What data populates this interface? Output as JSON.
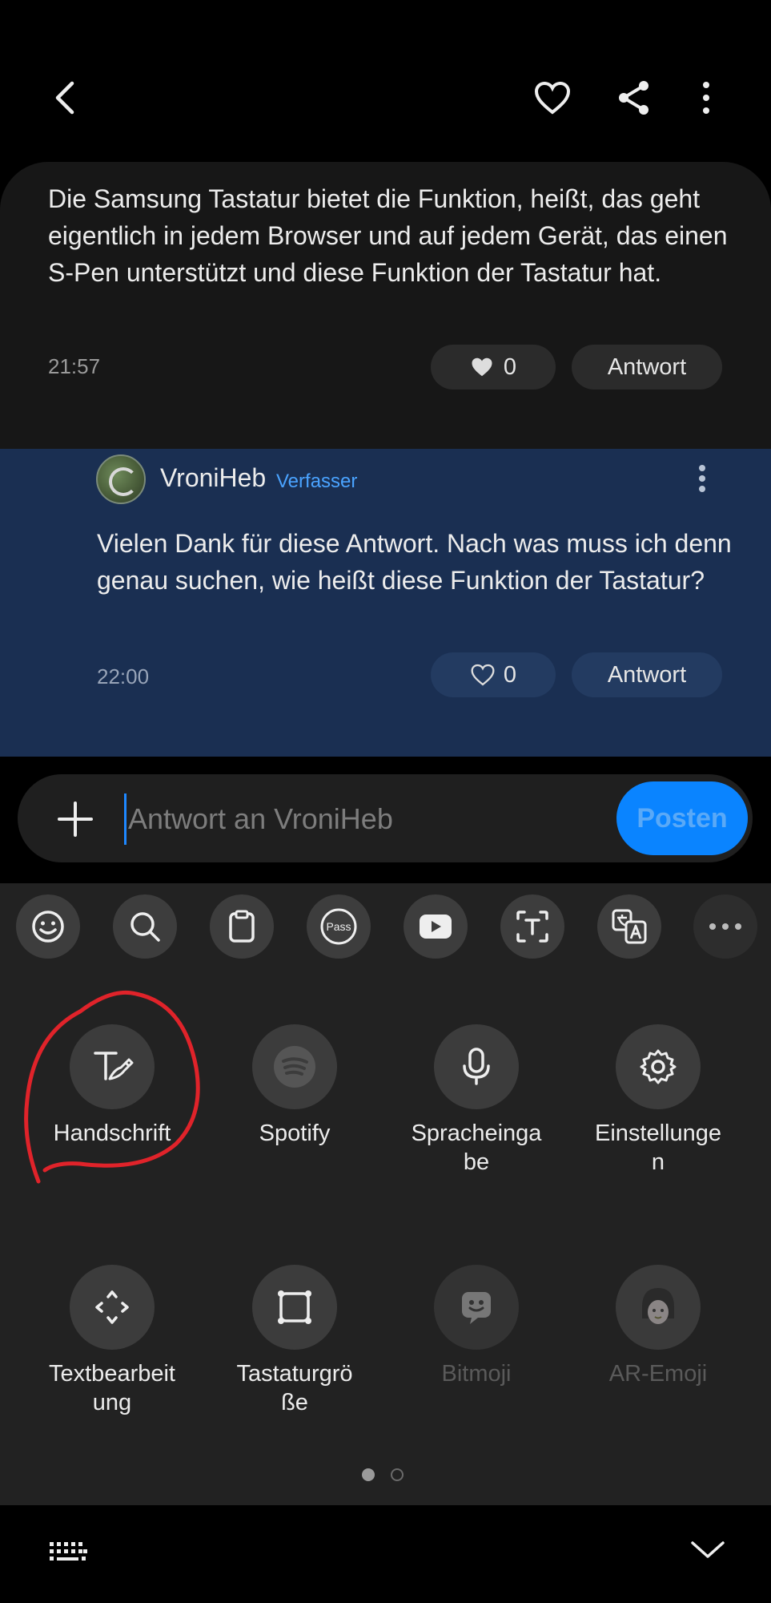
{
  "topbar": {
    "back_icon": "back-arrow-icon",
    "favorite_icon": "heart-outline-icon",
    "share_icon": "share-icon",
    "more_icon": "more-vertical-icon"
  },
  "comment": {
    "text": "Die Samsung Tastatur bietet die Funktion, heißt, das geht eigentlich in jedem Browser und auf jedem Gerät, das einen S-Pen unterstützt und diese Funktion der Tastatur hat.",
    "time": "21:57",
    "likes": "0",
    "reply_label": "Antwort"
  },
  "reply": {
    "author": "VroniHeb",
    "badge": "Verfasser",
    "text": "Vielen Dank für diese Antwort. Nach was muss ich denn genau suchen, wie heißt diese Funktion der Tastatur?",
    "time": "22:00",
    "likes": "0",
    "reply_label": "Antwort"
  },
  "input": {
    "placeholder": "Antwort an VroniHeb",
    "value": "",
    "post_label": "Posten"
  },
  "keyboard": {
    "toolbar": [
      {
        "icon": "emoji-icon"
      },
      {
        "icon": "search-icon"
      },
      {
        "icon": "clipboard-icon"
      },
      {
        "icon": "samsung-pass-icon",
        "text": "Pass"
      },
      {
        "icon": "youtube-icon"
      },
      {
        "icon": "text-extract-icon"
      },
      {
        "icon": "translate-icon"
      },
      {
        "icon": "more-horizontal-icon"
      }
    ],
    "tiles": [
      {
        "label": "Handschrift",
        "icon": "handwriting-icon",
        "enabled": true
      },
      {
        "label": "Spotify",
        "icon": "spotify-icon",
        "enabled": true
      },
      {
        "label": "Spracheinga\nbe",
        "icon": "microphone-icon",
        "enabled": true
      },
      {
        "label": "Einstellunge\nn",
        "icon": "gear-icon",
        "enabled": true
      },
      {
        "label": "Textbearbeit\nung",
        "icon": "text-editing-icon",
        "enabled": true
      },
      {
        "label": "Tastaturgrö\nße",
        "icon": "keyboard-size-icon",
        "enabled": true
      },
      {
        "label": "Bitmoji",
        "icon": "bitmoji-icon",
        "enabled": false
      },
      {
        "label": "AR-Emoji",
        "icon": "ar-emoji-icon",
        "enabled": false
      }
    ],
    "page_indicator": {
      "pages": 2,
      "current": 1
    }
  },
  "bottom": {
    "keyboard_switch_icon": "keyboard-icon",
    "hide_icon": "chevron-down-icon"
  },
  "colors": {
    "accent": "#0a84ff",
    "author_badge": "#4aa3ff",
    "reply_highlight": "#1a2f52",
    "annotation_red": "#e0232a"
  }
}
